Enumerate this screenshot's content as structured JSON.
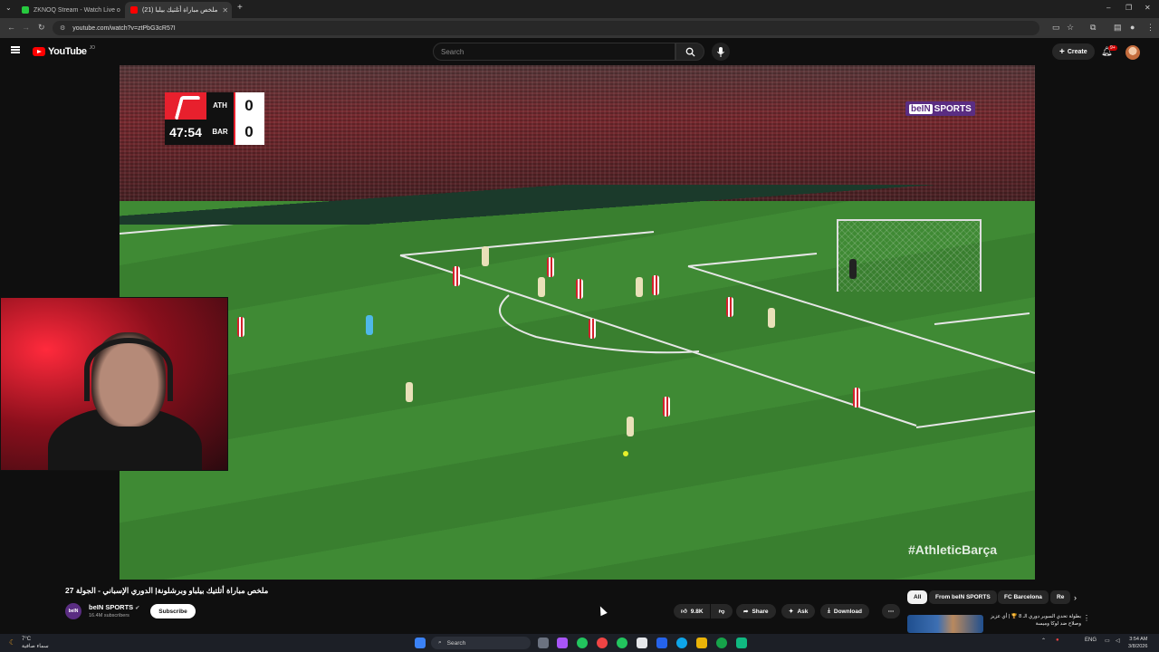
{
  "browser": {
    "tabs": [
      {
        "title": "ZKNOQ Stream - Watch Live o",
        "active": false
      },
      {
        "title": "(21) ملخص مباراة أتلتيك بيلبا",
        "active": true
      }
    ],
    "url": "youtube.com/watch?v=ztPbG3cR57I"
  },
  "youtube": {
    "logo_text": "YouTube",
    "region": "JO",
    "search_placeholder": "Search",
    "create_label": "Create",
    "notifications": "9+"
  },
  "video": {
    "scoreboard": {
      "clock": "47:54",
      "home_team": "ATH",
      "away_team": "BAR",
      "home_score": "0",
      "away_score": "0"
    },
    "broadcaster": {
      "b": "beIN",
      "rest": "SPORTS"
    },
    "hashtag": "#AthleticBarça",
    "title": "ملخص مباراة أتلتيك بيلباو وبرشلونة| الدوري الإسباني - الجولة 27",
    "channel": {
      "name": "beIN SPORTS",
      "verified": "✔",
      "subscribers": "16.4M subscribers",
      "avatar_text": "beIN"
    },
    "subscribe_label": "Subscribe",
    "actions": {
      "likes": "9.8K",
      "share": "Share",
      "ask": "Ask",
      "download": "Download",
      "more": "⋯"
    }
  },
  "sidebar": {
    "chips": [
      "All",
      "From beIN SPORTS",
      "FC Barcelona",
      "Re"
    ],
    "recommendation_title": "بطولة تحدي السوبر دوري الـ 8 🏆 | أي عزيز وصلاح ضد لوكا وميسة"
  },
  "taskbar": {
    "weather_temp": "7°C",
    "weather_desc": "سماء صافية",
    "search_label": "Search",
    "language": "ENG",
    "time": "3:54 AM",
    "date": "3/8/2026"
  },
  "colors": {
    "yt_red": "#ff0000",
    "bein_purple": "#5a2d82",
    "laliga_red": "#e8202d"
  }
}
